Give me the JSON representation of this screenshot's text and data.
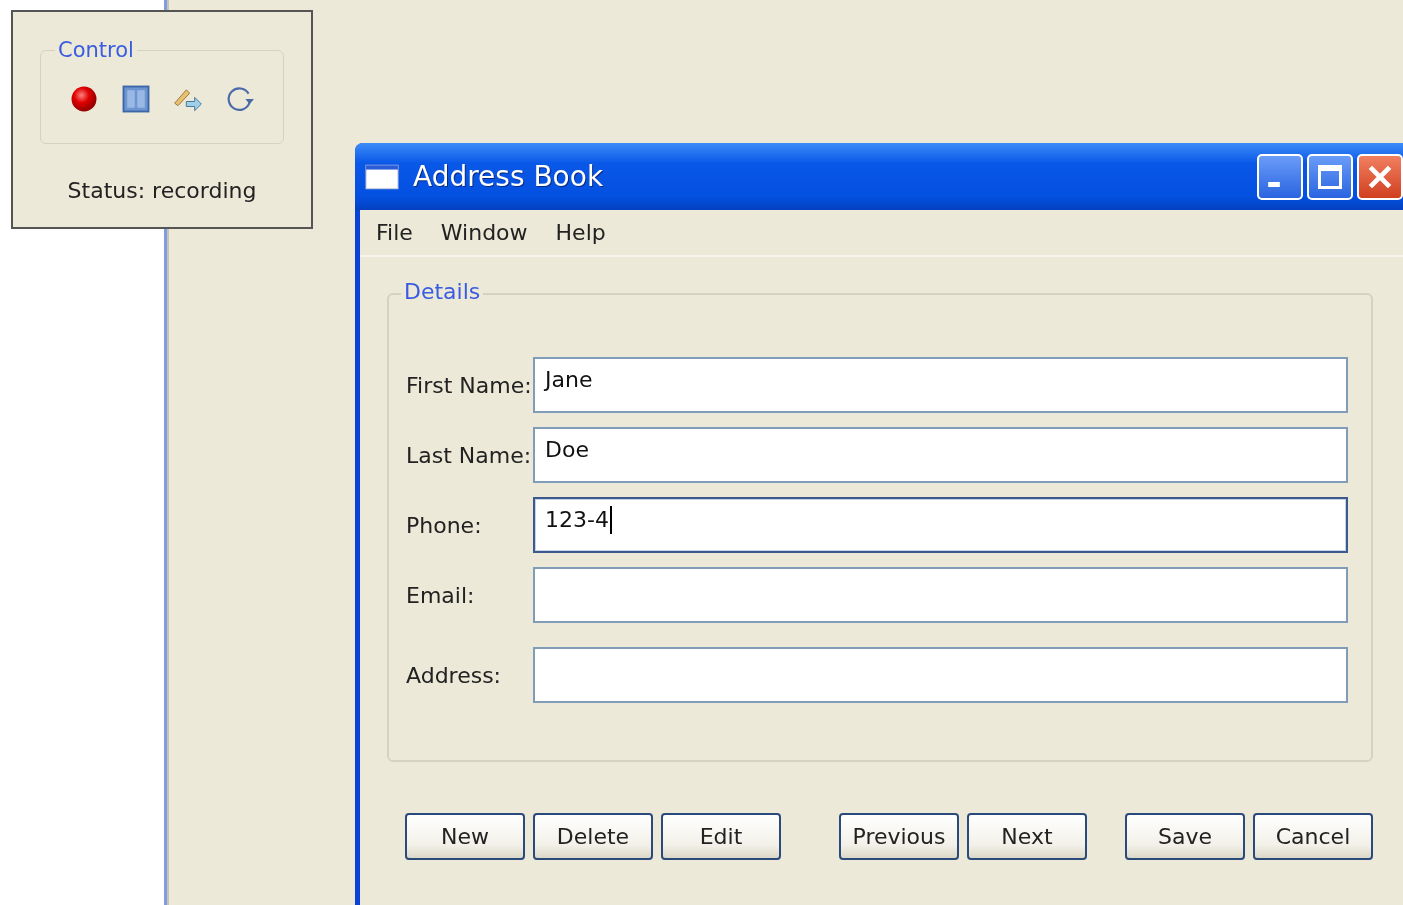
{
  "control_window": {
    "group_title": "Control",
    "status": "Status: recording"
  },
  "window": {
    "title": "Address Book"
  },
  "menu": [
    "File",
    "Window",
    "Help"
  ],
  "details": {
    "title": "Details",
    "fields": [
      {
        "label": "First Name:",
        "value": "Jane",
        "focused": false
      },
      {
        "label": "Last Name:",
        "value": "Doe",
        "focused": false
      },
      {
        "label": "Phone:",
        "value": "123-4",
        "focused": true
      },
      {
        "label": "Email:",
        "focused": false
      },
      {
        "label": "Address:",
        "focused": false
      }
    ]
  },
  "button_groups": [
    [
      "New",
      "Delete",
      "Edit"
    ],
    [
      "Previous",
      "Next"
    ],
    [
      "Save",
      "Cancel"
    ]
  ]
}
